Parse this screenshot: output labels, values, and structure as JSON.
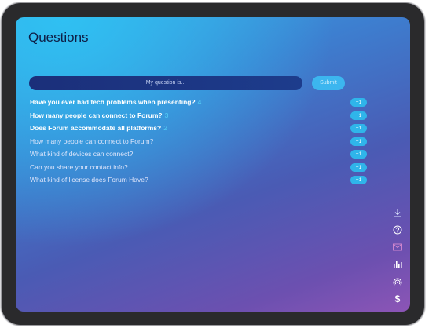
{
  "page": {
    "title": "Questions"
  },
  "form": {
    "placeholder": "My question is...",
    "submit_label": "Submit"
  },
  "questions": [
    {
      "text": "Have you ever had tech problems when presenting?",
      "count": "4",
      "bold": true,
      "vote_label": "+1"
    },
    {
      "text": "How many people can connect to Forum?",
      "count": "3",
      "bold": true,
      "vote_label": "+1"
    },
    {
      "text": "Does Forum accommodate all platforms?",
      "count": "2",
      "bold": true,
      "vote_label": "+1"
    },
    {
      "text": "How many people can connect to Forum?",
      "count": "",
      "bold": false,
      "vote_label": "+1"
    },
    {
      "text": "What kind of devices can connect?",
      "count": "",
      "bold": false,
      "vote_label": "+1"
    },
    {
      "text": "Can you share your contact info?",
      "count": "",
      "bold": false,
      "vote_label": "+1"
    },
    {
      "text": "What kind of license does Forum Have?",
      "count": "",
      "bold": false,
      "vote_label": "+1"
    }
  ],
  "sidebar": {
    "icons": [
      "download-icon",
      "question-icon",
      "mail-icon",
      "bar-chart-icon",
      "broadcast-icon",
      "dollar-icon"
    ],
    "dollar_glyph": "$"
  },
  "colors": {
    "accent": "#2fb5ea",
    "input_bg": "#1b2f7a",
    "title": "#0e1d44"
  }
}
